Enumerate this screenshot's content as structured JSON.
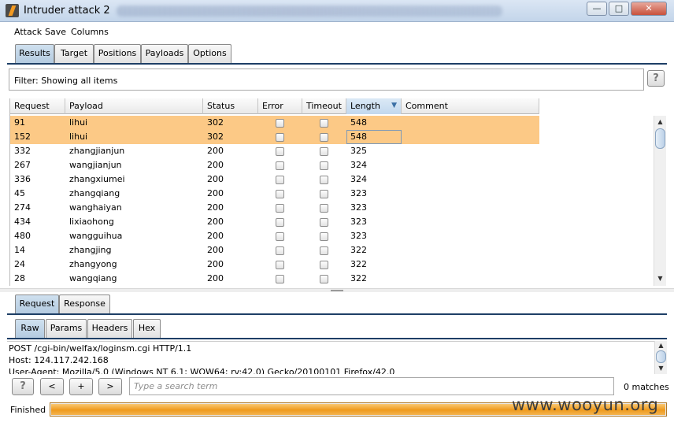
{
  "window": {
    "title": "Intruder attack 2",
    "controls": {
      "minimize": "—",
      "maximize": "□",
      "close": "✕"
    }
  },
  "menu": [
    "Attack",
    "Save",
    "Columns"
  ],
  "top_tabs": [
    {
      "label": "Results",
      "active": true
    },
    {
      "label": "Target",
      "active": false
    },
    {
      "label": "Positions",
      "active": false
    },
    {
      "label": "Payloads",
      "active": false
    },
    {
      "label": "Options",
      "active": false
    }
  ],
  "filter": {
    "text": "Filter:  Showing all items",
    "help": "?"
  },
  "table": {
    "columns": [
      "Request",
      "Payload",
      "Status",
      "Error",
      "Timeout",
      "Length",
      "Comment"
    ],
    "sorted_column": "Length",
    "rows": [
      {
        "request": "91",
        "payload": "lihui",
        "status": "302",
        "length": "548",
        "selected": true
      },
      {
        "request": "152",
        "payload": "lihui",
        "status": "302",
        "length": "548",
        "selected": true
      },
      {
        "request": "332",
        "payload": "zhangjianjun",
        "status": "200",
        "length": "325",
        "selected": false
      },
      {
        "request": "267",
        "payload": "wangjianjun",
        "status": "200",
        "length": "324",
        "selected": false
      },
      {
        "request": "336",
        "payload": "zhangxiumei",
        "status": "200",
        "length": "324",
        "selected": false
      },
      {
        "request": "45",
        "payload": "zhangqiang",
        "status": "200",
        "length": "323",
        "selected": false
      },
      {
        "request": "274",
        "payload": "wanghaiyan",
        "status": "200",
        "length": "323",
        "selected": false
      },
      {
        "request": "434",
        "payload": "lixiaohong",
        "status": "200",
        "length": "323",
        "selected": false
      },
      {
        "request": "480",
        "payload": "wangguihua",
        "status": "200",
        "length": "323",
        "selected": false
      },
      {
        "request": "14",
        "payload": "zhangjing",
        "status": "200",
        "length": "322",
        "selected": false
      },
      {
        "request": "24",
        "payload": "zhangyong",
        "status": "200",
        "length": "322",
        "selected": false
      },
      {
        "request": "28",
        "payload": "wangqiang",
        "status": "200",
        "length": "322",
        "selected": false
      }
    ]
  },
  "detail_tabs": [
    {
      "label": "Request",
      "active": true
    },
    {
      "label": "Response",
      "active": false
    }
  ],
  "view_tabs": [
    {
      "label": "Raw",
      "active": true
    },
    {
      "label": "Params",
      "active": false
    },
    {
      "label": "Headers",
      "active": false
    },
    {
      "label": "Hex",
      "active": false
    }
  ],
  "raw_request": [
    "POST /cgi-bin/welfax/loginsm.cgi HTTP/1.1",
    "Host: 124.117.242.168",
    "User-Agent: Mozilla/5.0 (Windows NT 6.1; WOW64; rv:42.0) Gecko/20100101 Firefox/42.0"
  ],
  "search": {
    "help": "?",
    "prev": "<",
    "add": "+",
    "next": ">",
    "placeholder": "Type a search term",
    "matches": "0 matches"
  },
  "status": {
    "text": "Finished",
    "progress": 1.0
  },
  "watermark": "www.wooyun.org",
  "colors": {
    "selected_row": "#fcc986",
    "progress": "#ef9a1c",
    "active_tab": "#b4cbe0"
  }
}
